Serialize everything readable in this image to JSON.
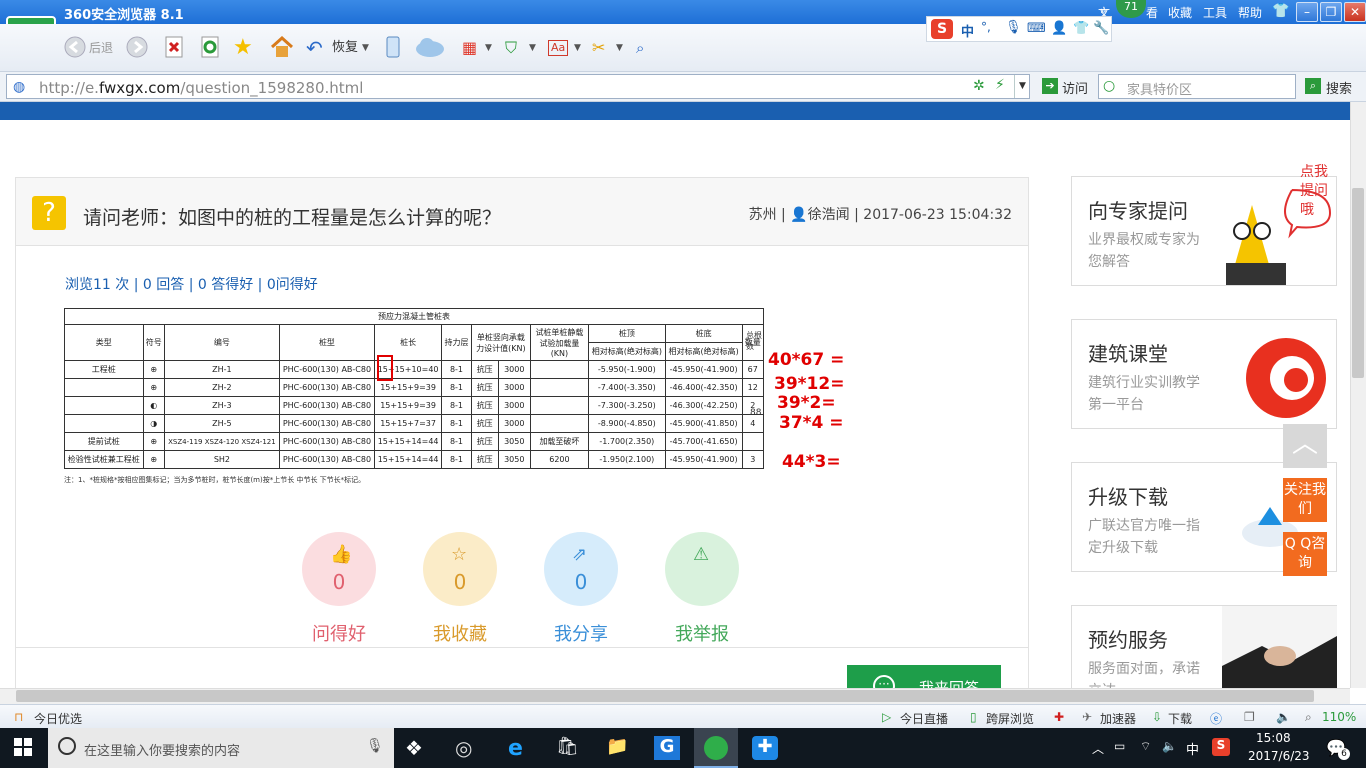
{
  "browser": {
    "title": "360安全浏览器 8.1",
    "badge": "71",
    "menu": [
      "文",
      "看",
      "收藏",
      "工具",
      "帮助"
    ],
    "win_controls": [
      "–",
      "❐",
      "✕"
    ],
    "toolbar": {
      "back": "后退",
      "restore": "恢复"
    },
    "ime": [
      "中",
      "°,"
    ],
    "url_prefix": "http://e.",
    "url_host": "fwxgx.com",
    "url_path": "/question_1598280.html",
    "visit": "访问",
    "search_placeholder": "家具特价区",
    "search_btn": "搜索"
  },
  "question": {
    "title": "请问老师：如图中的桩的工程量是怎么计算的呢？",
    "city": "苏州",
    "user": "徐浩闻",
    "datetime": "2017-06-23 15:04:32",
    "stats": "浏览11 次 | 0 回答 | 0 答得好 | 0问得好"
  },
  "table": {
    "title": "预应力混凝土管桩表",
    "headers": [
      "类型",
      "符号",
      "编号",
      "桩型",
      "桩长",
      "持力层",
      "单桩竖向承载力设计值(KN)",
      "试桩单桩静载试验加载量(KN)",
      "桩顶",
      "桩底",
      "数量",
      "总根数"
    ],
    "subheaders": [
      "相对标高(绝对标高)",
      "相对标高(绝对标高)"
    ],
    "rows": [
      [
        "工程桩",
        "ZH-1",
        "PHC-600(130) AB-C80",
        "15+15+10=40",
        "8-1",
        "抗压",
        "3000",
        "",
        "-5.950(-1.900)",
        "-45.950(-41.900)",
        "67"
      ],
      [
        "",
        "ZH-2",
        "PHC-600(130) AB-C80",
        "15+15+9=39",
        "8-1",
        "抗压",
        "3000",
        "",
        "-7.400(-3.350)",
        "-46.400(-42.350)",
        "12"
      ],
      [
        "",
        "ZH-3",
        "PHC-600(130) AB-C80",
        "15+15+9=39",
        "8-1",
        "抗压",
        "3000",
        "",
        "-7.300(-3.250)",
        "-46.300(-42.250)",
        "2"
      ],
      [
        "",
        "ZH-5",
        "PHC-600(130) AB-C80",
        "15+15+7=37",
        "8-1",
        "抗压",
        "3000",
        "",
        "-8.900(-4.850)",
        "-45.900(-41.850)",
        "4"
      ],
      [
        "提前试桩",
        "XSZ4-119 XSZ4-120 XSZ4-121",
        "PHC-600(130) AB-C80",
        "15+15+14=44",
        "8-1",
        "抗压",
        "3050",
        "加载至破坏",
        "-1.700(2.350)",
        "-45.700(-41.650)",
        ""
      ],
      [
        "检验性试桩兼工程桩",
        "SH2",
        "PHC-600(130) AB-C80",
        "15+15+14=44",
        "8-1",
        "抗压",
        "3050",
        "6200",
        "-1.950(2.100)",
        "-45.950(-41.900)",
        "3"
      ]
    ],
    "total": "88",
    "note": "注：1、*桩规格*按相应图集标记；当为多节桩时，桩节长度(m)按*上节长 中节长 下节长*标记。"
  },
  "annotations": [
    "40*67 =",
    "39*12=",
    "39*2=",
    "37*4 =",
    "44*3="
  ],
  "actions": [
    {
      "label": "问得好",
      "count": "0",
      "icon": "thumbs-up-icon",
      "bg": "#fbdde0",
      "color": "#e0606e"
    },
    {
      "label": "我收藏",
      "count": "0",
      "icon": "star-icon",
      "bg": "#fbecc8",
      "color": "#d99a2b"
    },
    {
      "label": "我分享",
      "count": "0",
      "icon": "share-icon",
      "bg": "#d6ecfb",
      "color": "#3a8fd8"
    },
    {
      "label": "我举报",
      "count": "0",
      "icon": "warning-icon",
      "bg": "#d9f2dd",
      "color": "#43a85a"
    }
  ],
  "answer_button": "我来回答",
  "sidebar": [
    {
      "title": "向专家提问",
      "sub": "业界最权威专家为您解答",
      "bubble": "点我提问哦"
    },
    {
      "title": "建筑课堂",
      "sub": "建筑行业实训教学第一平台"
    },
    {
      "title": "升级下载",
      "sub": "广联达官方唯一指定升级下载"
    },
    {
      "title": "预约服务",
      "sub": "服务面对面，承诺立达"
    }
  ],
  "float": {
    "up": "︿",
    "follow": "关注我们",
    "qq": "Q Q咨询"
  },
  "statusbar": {
    "left": "今日优选",
    "live": "今日直播",
    "cross": "跨屏浏览",
    "accel": "加速器",
    "download": "下载",
    "zoom": "110%"
  },
  "taskbar": {
    "search": "在这里输入你要搜索的内容",
    "ime": "中",
    "time": "15:08",
    "date": "2017/6/23",
    "notif": "6"
  }
}
